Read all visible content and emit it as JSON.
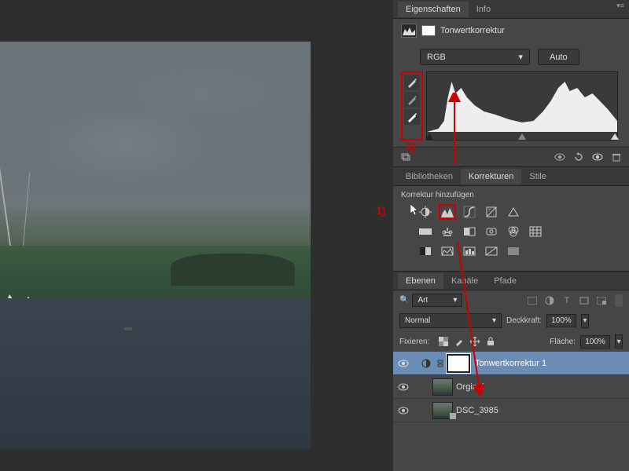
{
  "properties": {
    "tab_props": "Eigenschaften",
    "tab_info": "Info",
    "title": "Tonwertkorrektur",
    "channel": "RGB",
    "auto": "Auto"
  },
  "adjustments": {
    "tab_lib": "Bibliotheken",
    "tab_adj": "Korrekturen",
    "tab_styles": "Stile",
    "add_label": "Korrektur hinzufügen"
  },
  "layers": {
    "tab_layers": "Ebenen",
    "tab_channels": "Kanäle",
    "tab_paths": "Pfade",
    "filter_kind": "Art",
    "blend_mode": "Normal",
    "opacity_label": "Deckkraft:",
    "opacity_value": "100%",
    "lock_label": "Fixieren:",
    "fill_label": "Fläche:",
    "fill_value": "100%",
    "items": [
      {
        "name": "Tonwertkorrektur 1"
      },
      {
        "name": "Orginal"
      },
      {
        "name": "DSC_3985"
      }
    ]
  },
  "annotations": {
    "one": "1)",
    "two": "2)"
  }
}
